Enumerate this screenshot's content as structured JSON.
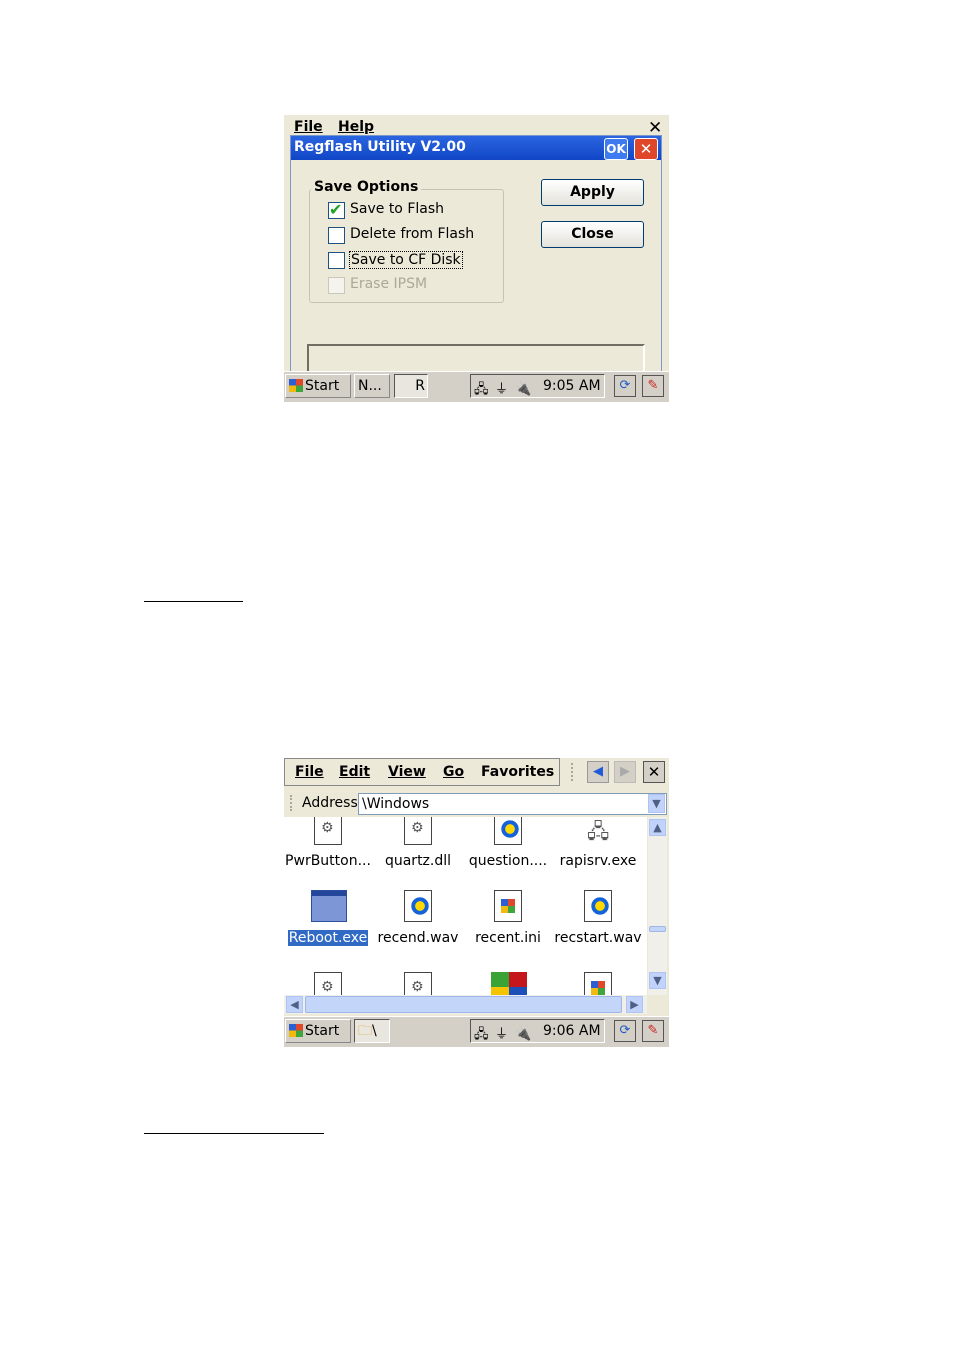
{
  "screenshot1": {
    "menu": [
      "File",
      "Help"
    ],
    "close_glyph": "✕",
    "dialog": {
      "title": "Regflash Utility V2.00",
      "ok_label": "OK",
      "close_glyph": "✕",
      "group_label": "Save Options",
      "options": [
        {
          "label": "Save to Flash",
          "checked": true,
          "disabled": false
        },
        {
          "label": "Delete from Flash",
          "checked": false,
          "disabled": false
        },
        {
          "label": "Save to CF Disk",
          "checked": false,
          "disabled": false
        },
        {
          "label": "Erase IPSM",
          "checked": false,
          "disabled": true
        }
      ],
      "apply_label": "Apply",
      "close_label": "Close"
    },
    "taskbar": {
      "start_label": "Start",
      "tasks": [
        "N...",
        "R"
      ],
      "time": "9:05 AM"
    }
  },
  "screenshot2": {
    "menu": [
      "File",
      "Edit",
      "View",
      "Go",
      "Favorites"
    ],
    "close_glyph": "✕",
    "address_label": "Address",
    "address_value": "\\Windows",
    "files": [
      {
        "name": "PwrButton...",
        "icon": "gear-document-icon"
      },
      {
        "name": "quartz.dll",
        "icon": "gear-document-icon"
      },
      {
        "name": "question....",
        "icon": "media-player-icon"
      },
      {
        "name": "rapisrv.exe",
        "icon": "network-devices-icon"
      },
      {
        "name": "Reboot.exe",
        "icon": "application-window-icon",
        "selected": true
      },
      {
        "name": "recend.wav",
        "icon": "media-player-icon"
      },
      {
        "name": "recent.ini",
        "icon": "ini-settings-icon"
      },
      {
        "name": "recstart.wav",
        "icon": "media-player-icon"
      }
    ],
    "taskbar": {
      "start_label": "Start",
      "task": "\\",
      "time": "9:06 AM"
    }
  },
  "colors": {
    "titlebar": "#1046c6",
    "selection": "#316ac5",
    "face": "#ece9d8",
    "taskbar": "#d4d0c8"
  }
}
